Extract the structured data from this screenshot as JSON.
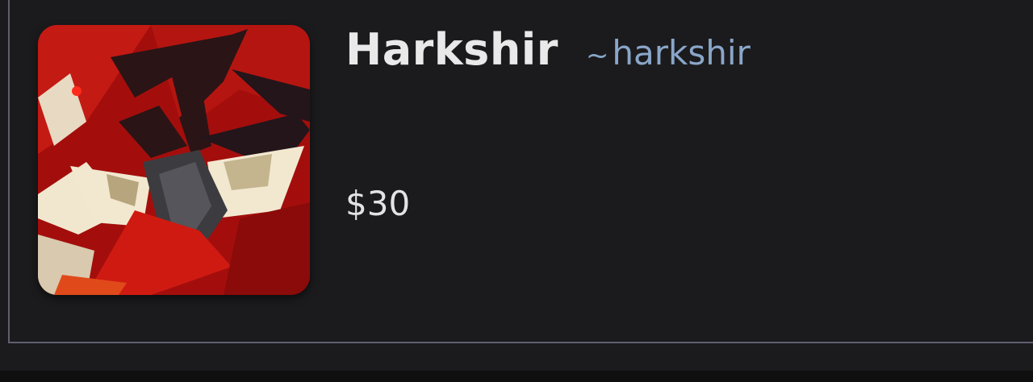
{
  "profile": {
    "display_name": "Harkshir",
    "username_prefix": "~",
    "username": "harkshir",
    "price": "$30",
    "avatar_alt": "avatar-icon"
  },
  "colors": {
    "background": "#1b1b1d",
    "border": "#5f5f72",
    "name": "#e9e9ea",
    "username": "#8aa6c9",
    "avatar_red": "#b8120f"
  }
}
